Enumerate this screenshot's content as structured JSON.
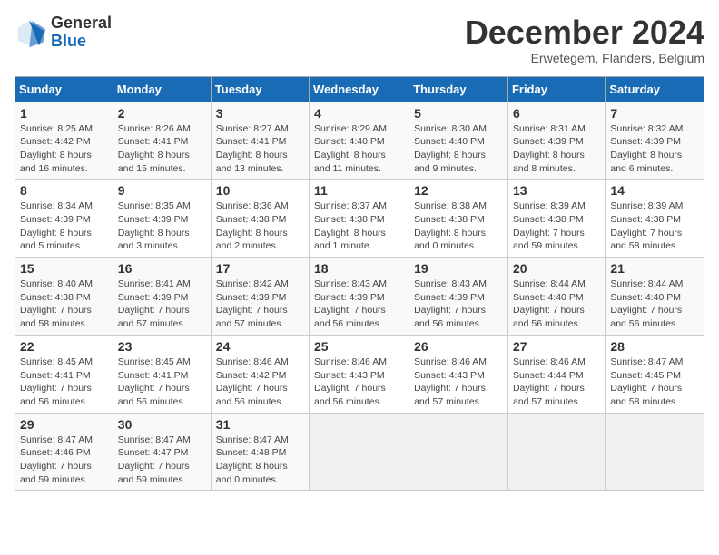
{
  "logo": {
    "general": "General",
    "blue": "Blue"
  },
  "header": {
    "month": "December 2024",
    "location": "Erwetegem, Flanders, Belgium"
  },
  "days_of_week": [
    "Sunday",
    "Monday",
    "Tuesday",
    "Wednesday",
    "Thursday",
    "Friday",
    "Saturday"
  ],
  "weeks": [
    [
      {
        "num": "1",
        "sunrise": "8:25 AM",
        "sunset": "4:42 PM",
        "daylight": "8 hours and 16 minutes."
      },
      {
        "num": "2",
        "sunrise": "8:26 AM",
        "sunset": "4:41 PM",
        "daylight": "8 hours and 15 minutes."
      },
      {
        "num": "3",
        "sunrise": "8:27 AM",
        "sunset": "4:41 PM",
        "daylight": "8 hours and 13 minutes."
      },
      {
        "num": "4",
        "sunrise": "8:29 AM",
        "sunset": "4:40 PM",
        "daylight": "8 hours and 11 minutes."
      },
      {
        "num": "5",
        "sunrise": "8:30 AM",
        "sunset": "4:40 PM",
        "daylight": "8 hours and 9 minutes."
      },
      {
        "num": "6",
        "sunrise": "8:31 AM",
        "sunset": "4:39 PM",
        "daylight": "8 hours and 8 minutes."
      },
      {
        "num": "7",
        "sunrise": "8:32 AM",
        "sunset": "4:39 PM",
        "daylight": "8 hours and 6 minutes."
      }
    ],
    [
      {
        "num": "8",
        "sunrise": "8:34 AM",
        "sunset": "4:39 PM",
        "daylight": "8 hours and 5 minutes."
      },
      {
        "num": "9",
        "sunrise": "8:35 AM",
        "sunset": "4:39 PM",
        "daylight": "8 hours and 3 minutes."
      },
      {
        "num": "10",
        "sunrise": "8:36 AM",
        "sunset": "4:38 PM",
        "daylight": "8 hours and 2 minutes."
      },
      {
        "num": "11",
        "sunrise": "8:37 AM",
        "sunset": "4:38 PM",
        "daylight": "8 hours and 1 minute."
      },
      {
        "num": "12",
        "sunrise": "8:38 AM",
        "sunset": "4:38 PM",
        "daylight": "8 hours and 0 minutes."
      },
      {
        "num": "13",
        "sunrise": "8:39 AM",
        "sunset": "4:38 PM",
        "daylight": "7 hours and 59 minutes."
      },
      {
        "num": "14",
        "sunrise": "8:39 AM",
        "sunset": "4:38 PM",
        "daylight": "7 hours and 58 minutes."
      }
    ],
    [
      {
        "num": "15",
        "sunrise": "8:40 AM",
        "sunset": "4:38 PM",
        "daylight": "7 hours and 58 minutes."
      },
      {
        "num": "16",
        "sunrise": "8:41 AM",
        "sunset": "4:39 PM",
        "daylight": "7 hours and 57 minutes."
      },
      {
        "num": "17",
        "sunrise": "8:42 AM",
        "sunset": "4:39 PM",
        "daylight": "7 hours and 57 minutes."
      },
      {
        "num": "18",
        "sunrise": "8:43 AM",
        "sunset": "4:39 PM",
        "daylight": "7 hours and 56 minutes."
      },
      {
        "num": "19",
        "sunrise": "8:43 AM",
        "sunset": "4:39 PM",
        "daylight": "7 hours and 56 minutes."
      },
      {
        "num": "20",
        "sunrise": "8:44 AM",
        "sunset": "4:40 PM",
        "daylight": "7 hours and 56 minutes."
      },
      {
        "num": "21",
        "sunrise": "8:44 AM",
        "sunset": "4:40 PM",
        "daylight": "7 hours and 56 minutes."
      }
    ],
    [
      {
        "num": "22",
        "sunrise": "8:45 AM",
        "sunset": "4:41 PM",
        "daylight": "7 hours and 56 minutes."
      },
      {
        "num": "23",
        "sunrise": "8:45 AM",
        "sunset": "4:41 PM",
        "daylight": "7 hours and 56 minutes."
      },
      {
        "num": "24",
        "sunrise": "8:46 AM",
        "sunset": "4:42 PM",
        "daylight": "7 hours and 56 minutes."
      },
      {
        "num": "25",
        "sunrise": "8:46 AM",
        "sunset": "4:43 PM",
        "daylight": "7 hours and 56 minutes."
      },
      {
        "num": "26",
        "sunrise": "8:46 AM",
        "sunset": "4:43 PM",
        "daylight": "7 hours and 57 minutes."
      },
      {
        "num": "27",
        "sunrise": "8:46 AM",
        "sunset": "4:44 PM",
        "daylight": "7 hours and 57 minutes."
      },
      {
        "num": "28",
        "sunrise": "8:47 AM",
        "sunset": "4:45 PM",
        "daylight": "7 hours and 58 minutes."
      }
    ],
    [
      {
        "num": "29",
        "sunrise": "8:47 AM",
        "sunset": "4:46 PM",
        "daylight": "7 hours and 59 minutes."
      },
      {
        "num": "30",
        "sunrise": "8:47 AM",
        "sunset": "4:47 PM",
        "daylight": "7 hours and 59 minutes."
      },
      {
        "num": "31",
        "sunrise": "8:47 AM",
        "sunset": "4:48 PM",
        "daylight": "8 hours and 0 minutes."
      },
      null,
      null,
      null,
      null
    ]
  ]
}
